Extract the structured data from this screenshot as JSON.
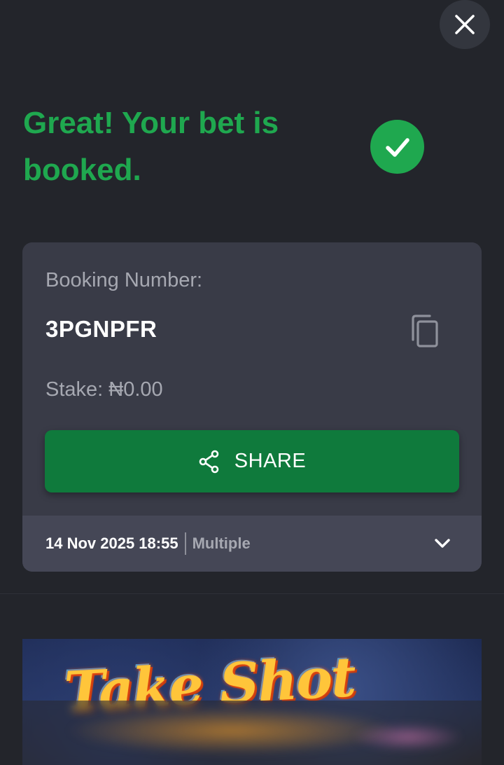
{
  "header": {
    "close_icon": "close-icon"
  },
  "confirmation": {
    "title": "Great! Your bet is booked.",
    "status_icon": "check-circle-icon",
    "accent_color": "#1fa84f"
  },
  "booking": {
    "label": "Booking Number:",
    "code": "3PGNPFR",
    "copy_icon": "copy-icon",
    "stake_label": "Stake:",
    "stake_amount": "₦0.00",
    "share_label": "SHARE",
    "share_icon": "share-icon",
    "share_color": "#0f7a3c",
    "date": "14 Nov 2025 18:55",
    "bet_type": "Multiple",
    "expand_icon": "chevron-down-icon"
  },
  "promo": {
    "banner_text": "Take Shot"
  }
}
